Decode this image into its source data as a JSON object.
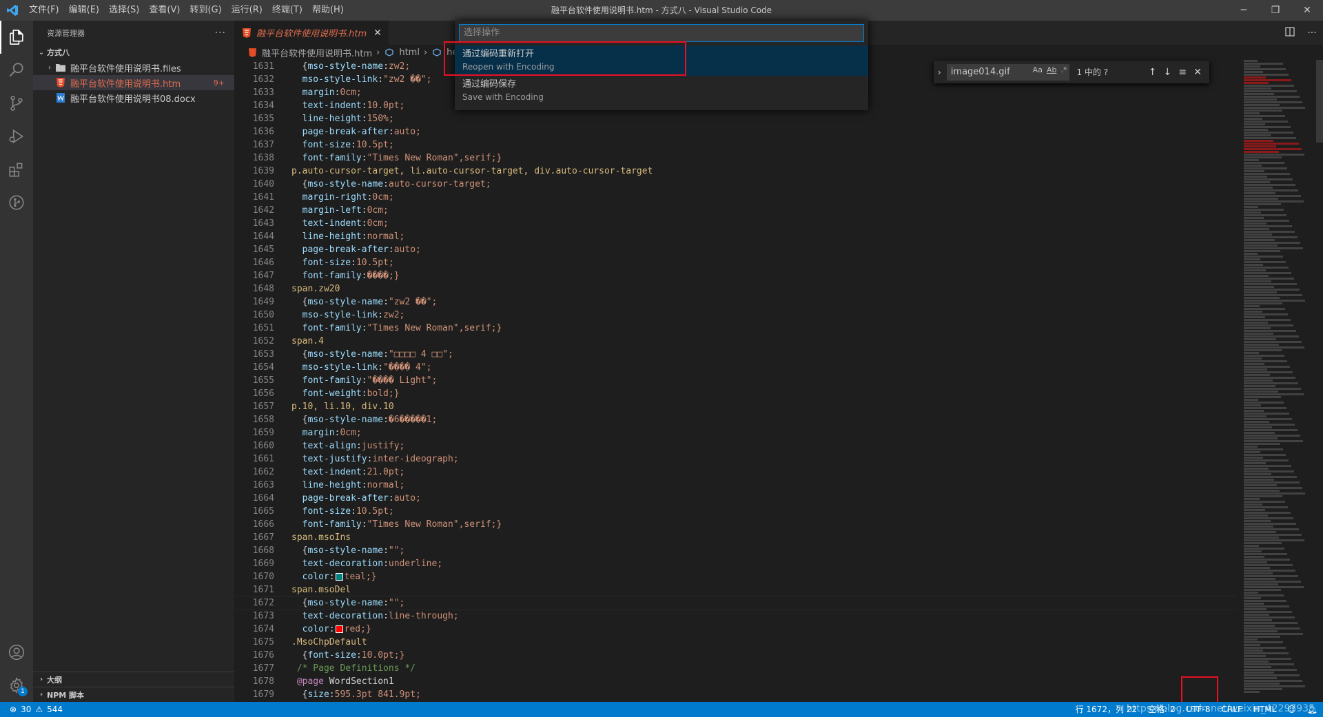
{
  "titlebar": {
    "menu": [
      "文件(F)",
      "编辑(E)",
      "选择(S)",
      "查看(V)",
      "转到(G)",
      "运行(R)",
      "终端(T)",
      "帮助(H)"
    ],
    "title": "融平台软件使用说明书.htm - 方式八 - Visual Studio Code",
    "minimize": "─",
    "maximize": "❐",
    "close": "✕"
  },
  "sidebar": {
    "header": "资源管理器",
    "more": "···",
    "root": "方式八",
    "items": [
      {
        "label": "融平台软件使用说明书.files",
        "type": "folder"
      },
      {
        "label": "融平台软件使用说明书.htm",
        "type": "html",
        "badge": "9+"
      },
      {
        "label": "融平台软件使用说明书08.docx",
        "type": "docx"
      }
    ],
    "outline": "大纲",
    "npm": "NPM 脚本"
  },
  "editor": {
    "tab_label": "融平台软件使用说明书.htm",
    "tab_close": "✕",
    "breadcrumb": [
      "融平台软件使用说明书.htm",
      "html",
      "head"
    ],
    "lines": [
      {
        "n": "1631",
        "t": "  {mso-style-name:zw2;"
      },
      {
        "n": "1632",
        "t": "  mso-style-link:\"zw2 ��\";"
      },
      {
        "n": "1633",
        "t": "  margin:0cm;"
      },
      {
        "n": "1634",
        "t": "  text-indent:10.0pt;"
      },
      {
        "n": "1635",
        "t": "  line-height:150%;"
      },
      {
        "n": "1636",
        "t": "  page-break-after:auto;"
      },
      {
        "n": "1637",
        "t": "  font-size:10.5pt;"
      },
      {
        "n": "1638",
        "t": "  font-family:\"Times New Roman\",serif;}"
      },
      {
        "n": "1639",
        "t": "p.auto-cursor-target, li.auto-cursor-target, div.auto-cursor-target"
      },
      {
        "n": "1640",
        "t": "  {mso-style-name:auto-cursor-target;"
      },
      {
        "n": "1641",
        "t": "  margin-right:0cm;"
      },
      {
        "n": "1642",
        "t": "  margin-left:0cm;"
      },
      {
        "n": "1643",
        "t": "  text-indent:0cm;"
      },
      {
        "n": "1644",
        "t": "  line-height:normal;"
      },
      {
        "n": "1645",
        "t": "  page-break-after:auto;"
      },
      {
        "n": "1646",
        "t": "  font-size:10.5pt;"
      },
      {
        "n": "1647",
        "t": "  font-family:����;}"
      },
      {
        "n": "1648",
        "t": "span.zw20"
      },
      {
        "n": "1649",
        "t": "  {mso-style-name:\"zw2 ��\";"
      },
      {
        "n": "1650",
        "t": "  mso-style-link:zw2;"
      },
      {
        "n": "1651",
        "t": "  font-family:\"Times New Roman\",serif;}"
      },
      {
        "n": "1652",
        "t": "span.4"
      },
      {
        "n": "1653",
        "t": "  {mso-style-name:\"□□□□ 4 □□\";"
      },
      {
        "n": "1654",
        "t": "  mso-style-link:\"���� 4\";"
      },
      {
        "n": "1655",
        "t": "  font-family:\"���� Light\";"
      },
      {
        "n": "1656",
        "t": "  font-weight:bold;}"
      },
      {
        "n": "1657",
        "t": "p.10, li.10, div.10"
      },
      {
        "n": "1658",
        "t": "  {mso-style-name:�6�����1;"
      },
      {
        "n": "1659",
        "t": "  margin:0cm;"
      },
      {
        "n": "1660",
        "t": "  text-align:justify;"
      },
      {
        "n": "1661",
        "t": "  text-justify:inter-ideograph;"
      },
      {
        "n": "1662",
        "t": "  text-indent:21.0pt;"
      },
      {
        "n": "1663",
        "t": "  line-height:normal;"
      },
      {
        "n": "1664",
        "t": "  page-break-after:auto;"
      },
      {
        "n": "1665",
        "t": "  font-size:10.5pt;"
      },
      {
        "n": "1666",
        "t": "  font-family:\"Times New Roman\",serif;}"
      },
      {
        "n": "1667",
        "t": "span.msoIns"
      },
      {
        "n": "1668",
        "t": "  {mso-style-name:\"\";"
      },
      {
        "n": "1669",
        "t": "  text-decoration:underline;"
      },
      {
        "n": "1670",
        "t": "  color:",
        "swatch": "#008080",
        "rest": "teal;}"
      },
      {
        "n": "1671",
        "t": "span.msoDel"
      },
      {
        "n": "1672",
        "t": "  {mso-style-name:\"\";"
      },
      {
        "n": "1673",
        "t": "  text-decoration:line-through;"
      },
      {
        "n": "1674",
        "t": "  color:",
        "swatch": "#ff0000",
        "rest": "red;}"
      },
      {
        "n": "1675",
        "t": ".MsoChpDefault"
      },
      {
        "n": "1676",
        "t": "  {font-size:10.0pt;}"
      },
      {
        "n": "1677",
        "t": " /* Page Definitions */",
        "cmt": true
      },
      {
        "n": "1678",
        "t": " @page WordSection1"
      },
      {
        "n": "1679",
        "t": "  {size:595.3pt 841.9pt;"
      }
    ]
  },
  "find": {
    "query": "image014.gif",
    "opts": [
      "Aa",
      "Ab",
      ".*"
    ],
    "count": "1 中的 ?",
    "prev": "↑",
    "next": "↓",
    "select": "≡",
    "close": "✕"
  },
  "quickpick": {
    "placeholder": "选择操作",
    "items": [
      {
        "label": "通过编码重新打开",
        "desc": "Reopen with Encoding"
      },
      {
        "label": "通过编码保存",
        "desc": "Save with Encoding"
      }
    ]
  },
  "statusbar": {
    "errors": "30",
    "warnings": "544",
    "position": "行 1672，列 22",
    "spaces": "空格: 2",
    "encoding": "UTF-8",
    "eol": "CRLF",
    "language": "HTML",
    "watermark": "https://blog.csdn.net/weixin_42297935"
  },
  "colors": {
    "accent": "#007acc",
    "highlight": "#e81123"
  }
}
